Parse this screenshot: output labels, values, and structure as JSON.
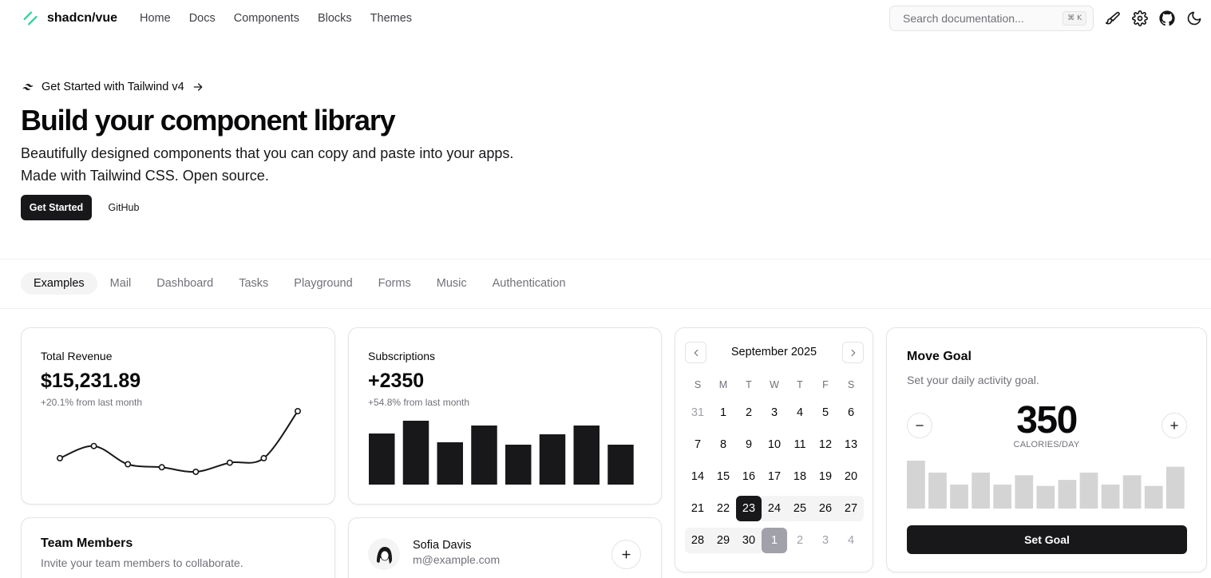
{
  "header": {
    "logo": "shadcn/vue",
    "nav": [
      "Home",
      "Docs",
      "Components",
      "Blocks",
      "Themes"
    ],
    "search_placeholder": "Search documentation...",
    "search_shortcut": "⌘ K"
  },
  "hero": {
    "announcement": "Get Started with Tailwind v4",
    "title": "Build your component library",
    "subtitle_line1": "Beautifully designed components that you can copy and paste into your apps.",
    "subtitle_line2": "Made with Tailwind CSS. Open source.",
    "primary_button": "Get Started",
    "secondary_button": "GitHub"
  },
  "tabs": [
    "Examples",
    "Mail",
    "Dashboard",
    "Tasks",
    "Playground",
    "Forms",
    "Music",
    "Authentication"
  ],
  "revenue": {
    "label": "Total Revenue",
    "value": "$15,231.89",
    "delta": "+20.1% from last month",
    "chart_data": {
      "type": "line",
      "values": [
        2.4,
        3.2,
        2.0,
        1.8,
        1.5,
        2.1,
        2.4,
        5.5
      ]
    }
  },
  "subscriptions": {
    "label": "Subscriptions",
    "value": "+2350",
    "delta": "+54.8% from last month",
    "chart_data": {
      "type": "bar",
      "values": [
        64,
        80,
        53,
        74,
        50,
        63,
        74,
        50
      ]
    }
  },
  "calendar": {
    "month": "September 2025",
    "weekdays": [
      "S",
      "M",
      "T",
      "W",
      "T",
      "F",
      "S"
    ],
    "weeks": [
      [
        "31",
        "1",
        "2",
        "3",
        "4",
        "5",
        "6"
      ],
      [
        "7",
        "8",
        "9",
        "10",
        "11",
        "12",
        "13"
      ],
      [
        "14",
        "15",
        "16",
        "17",
        "18",
        "19",
        "20"
      ],
      [
        "21",
        "22",
        "23",
        "24",
        "25",
        "26",
        "27"
      ],
      [
        "28",
        "29",
        "30",
        "1",
        "2",
        "3",
        "4"
      ]
    ],
    "selected_day": "23"
  },
  "goal": {
    "title": "Move Goal",
    "description": "Set your daily activity goal.",
    "value": "350",
    "unit": "CALORIES/DAY",
    "button": "Set Goal",
    "chart_data": {
      "type": "bar",
      "values": [
        400,
        300,
        200,
        300,
        200,
        278,
        189,
        239,
        300,
        200,
        278,
        189,
        349
      ]
    }
  },
  "team": {
    "title": "Team Members",
    "description": "Invite your team members to collaborate."
  },
  "person": {
    "name": "Sofia Davis",
    "email": "m@example.com"
  },
  "colors": {
    "primary": "#18181b",
    "muted": "#71717a",
    "border": "#e4e4e7",
    "logo_green": "#34d399",
    "goal_bar": "#d4d4d4"
  }
}
